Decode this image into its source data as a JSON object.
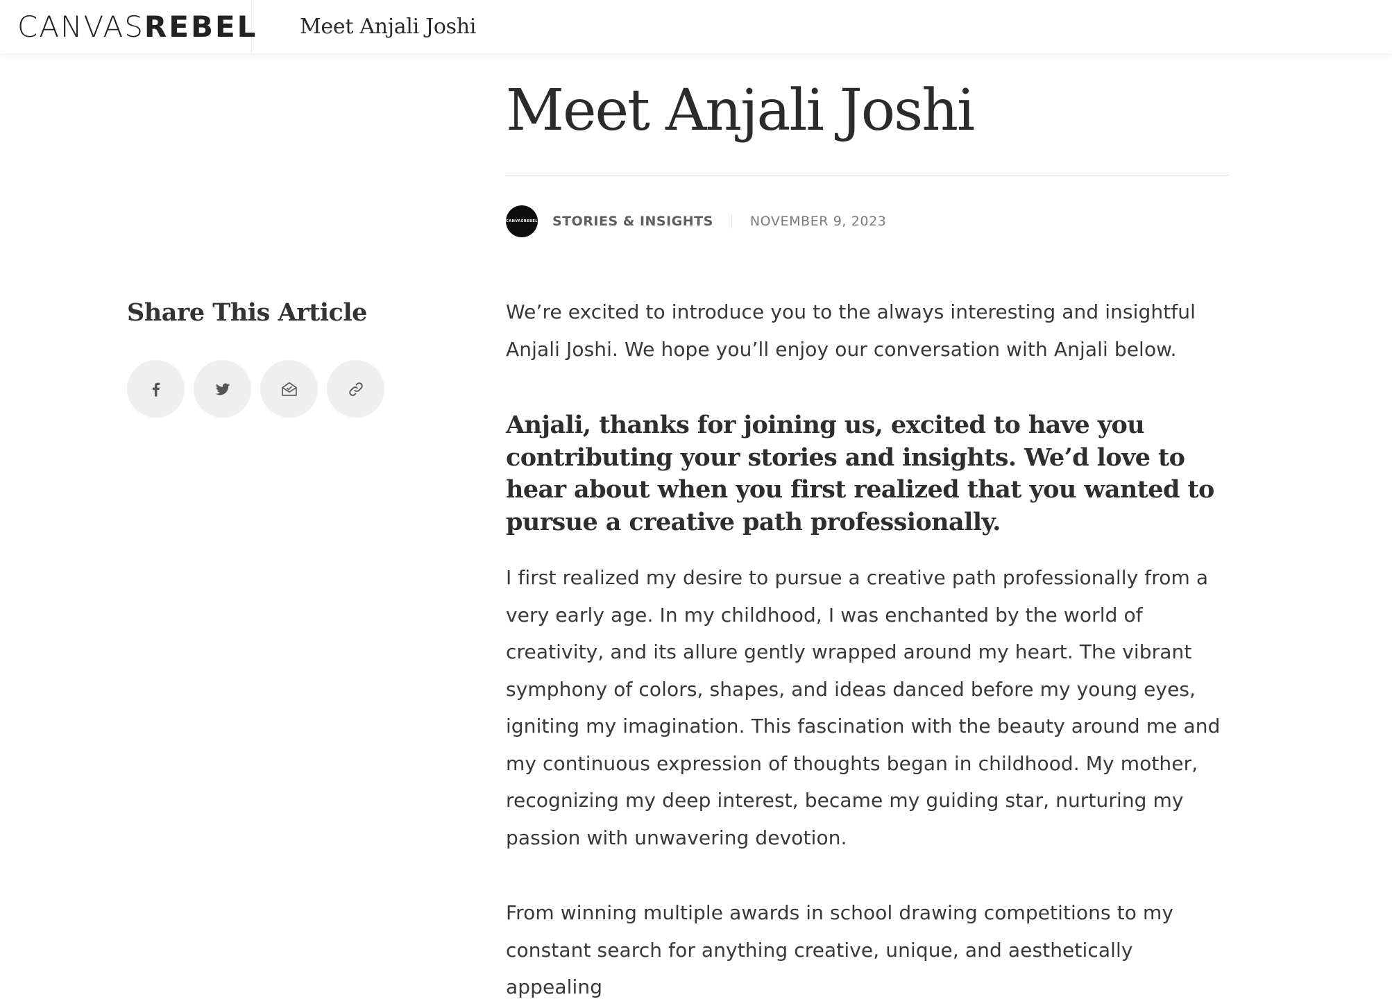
{
  "topbar": {
    "brand_light": "CANVAS",
    "brand_bold": "REBEL",
    "title": "Meet Anjali Joshi"
  },
  "article": {
    "headline": "Meet Anjali Joshi",
    "avatar_light": "CANVAS",
    "avatar_bold": "REBEL",
    "category": "STORIES & INSIGHTS",
    "date": "NOVEMBER 9, 2023",
    "intro": "We’re excited to introduce you to the always interesting and insightful Anjali Joshi. We hope you’ll enjoy our conversation with Anjali below.",
    "question": "Anjali, thanks for joining us, excited to have you contributing your stories and insights. We’d love to hear about when you first realized that you wanted to pursue a creative path professionally.",
    "answer": "I first realized my desire to pursue a creative path professionally from a very early age. In my childhood, I was enchanted by the world of creativity, and its allure gently wrapped around my heart. The vibrant symphony of colors, shapes, and ideas danced before my young eyes, igniting my imagination. This fascination with the beauty around me and my continuous expression of thoughts began in childhood. My mother, recognizing my deep interest, became my guiding star, nurturing my passion with unwavering devotion.",
    "answer_2": "From winning multiple awards in school drawing competitions to my constant search for anything creative, unique, and aesthetically appealing"
  },
  "share": {
    "title": "Share This Article",
    "buttons": [
      {
        "icon": "facebook-icon"
      },
      {
        "icon": "twitter-icon"
      },
      {
        "icon": "email-icon"
      },
      {
        "icon": "link-icon"
      }
    ]
  }
}
